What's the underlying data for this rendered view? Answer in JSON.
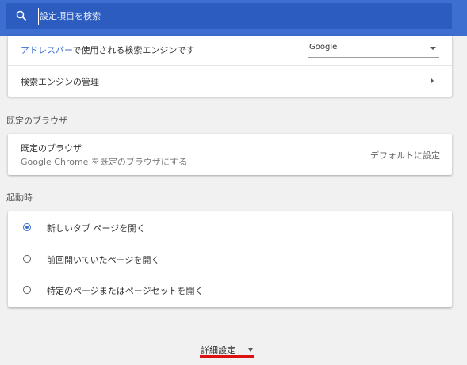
{
  "search": {
    "placeholder": "設定項目を検索",
    "icon": "search-icon"
  },
  "search_engine": {
    "label_link": "アドレスバー",
    "label_rest": "で使用される検索エンジンです",
    "selected": "Google",
    "manage_label": "検索エンジンの管理"
  },
  "default_browser": {
    "section_title": "既定のブラウザ",
    "title": "既定のブラウザ",
    "subtitle": "Google Chrome を既定のブラウザにする",
    "button_label": "デフォルトに設定"
  },
  "startup": {
    "section_title": "起動時",
    "options": [
      {
        "label": "新しいタブ ページを開く",
        "selected": true
      },
      {
        "label": "前回開いていたページを開く",
        "selected": false
      },
      {
        "label": "特定のページまたはページセットを開く",
        "selected": false
      }
    ]
  },
  "advanced": {
    "label": "詳細設定"
  },
  "colors": {
    "accent": "#3d6fd1",
    "topbar": "#3d6fd1",
    "underline": "#dd1111",
    "background": "#f1f1f1"
  }
}
